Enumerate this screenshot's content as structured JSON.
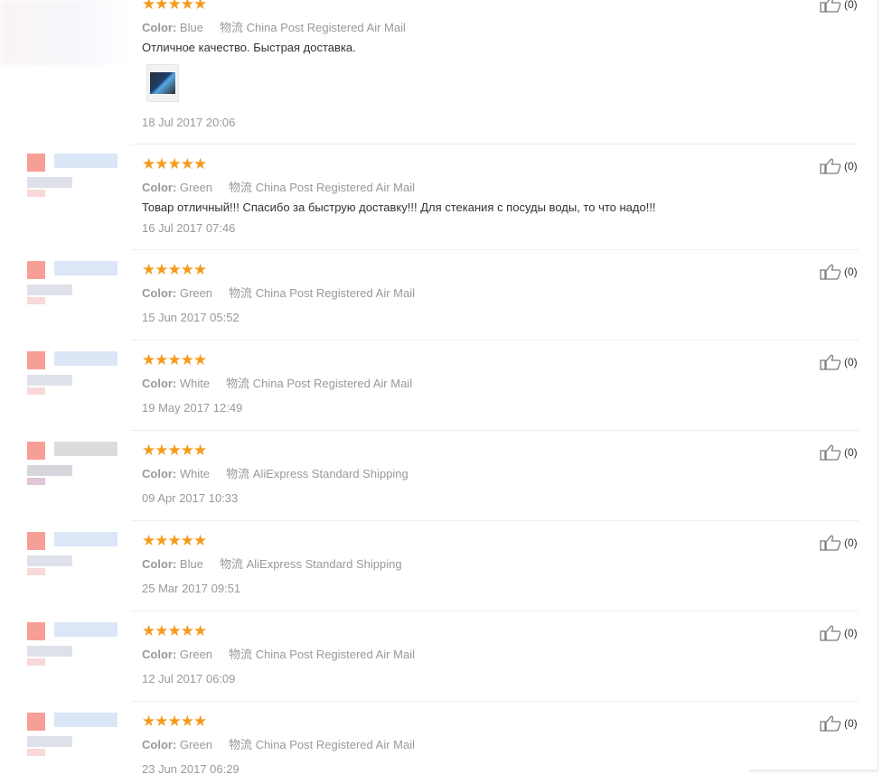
{
  "reviews": [
    {
      "stars": "★★★★★",
      "color_label": "Color:",
      "color_value": "Blue",
      "shipping_label": "物流",
      "shipping_value": "China Post Registered Air Mail",
      "feedback": "Отличное качество. Быстрая доставка.",
      "has_photo": true,
      "date": "18 Jul 2017 20:06",
      "likes": "(0)"
    },
    {
      "stars": "★★★★★",
      "color_label": "Color:",
      "color_value": "Green",
      "shipping_label": "物流",
      "shipping_value": "China Post Registered Air Mail",
      "feedback": "Товар отличный!!! Спасибо за быструю доставку!!! Для стекания с посуды воды, то что надо!!!",
      "date": "16 Jul 2017 07:46",
      "likes": "(0)"
    },
    {
      "stars": "★★★★★",
      "color_label": "Color:",
      "color_value": "Green",
      "shipping_label": "物流",
      "shipping_value": "China Post Registered Air Mail",
      "date": "15 Jun 2017 05:52",
      "likes": "(0)"
    },
    {
      "stars": "★★★★★",
      "color_label": "Color:",
      "color_value": "White",
      "shipping_label": "物流",
      "shipping_value": "China Post Registered Air Mail",
      "date": "19 May 2017 12:49",
      "likes": "(0)"
    },
    {
      "stars": "★★★★★",
      "color_label": "Color:",
      "color_value": "White",
      "shipping_label": "物流",
      "shipping_value": "AliExpress Standard Shipping",
      "date": "09 Apr 2017 10:33",
      "likes": "(0)"
    },
    {
      "stars": "★★★★★",
      "color_label": "Color:",
      "color_value": "Blue",
      "shipping_label": "物流",
      "shipping_value": "AliExpress Standard Shipping",
      "date": "25 Mar 2017 09:51",
      "likes": "(0)"
    },
    {
      "stars": "★★★★★",
      "color_label": "Color:",
      "color_value": "Green",
      "shipping_label": "物流",
      "shipping_value": "China Post Registered Air Mail",
      "date": "12 Jul 2017 06:09",
      "likes": "(0)"
    },
    {
      "stars": "★★★★★",
      "color_label": "Color:",
      "color_value": "Green",
      "shipping_label": "物流",
      "shipping_value": "China Post Registered Air Mail",
      "date": "23 Jun 2017 06:29",
      "likes": "(0)"
    }
  ],
  "colors": {
    "star": "#f49b1d",
    "muted_text": "#999999",
    "body_text": "#333333"
  },
  "icons": {
    "like": "thumbs-up-icon",
    "star": "star-icon"
  }
}
